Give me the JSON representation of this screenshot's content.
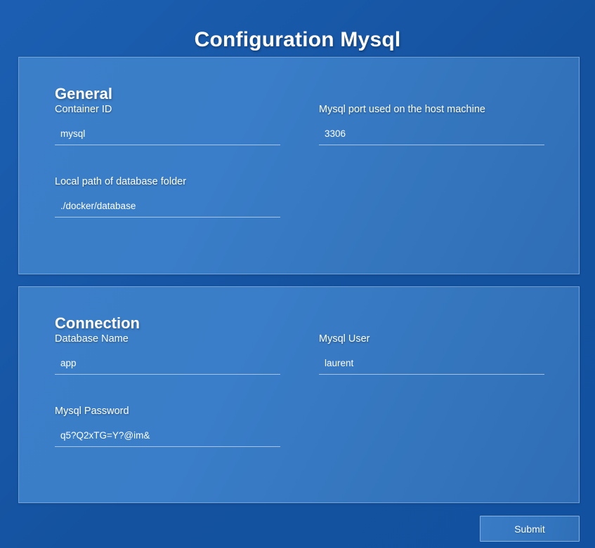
{
  "page": {
    "title": "Configuration Mysql",
    "background_color": "#1a5aab",
    "card_color": "#3a7dc8",
    "text_color": "#ffffff"
  },
  "sections": [
    {
      "id": "general",
      "title": "General",
      "rows": [
        {
          "left": {
            "label": "Container ID",
            "value": "mysql",
            "placeholder": "Container ID"
          },
          "right": {
            "label": "Mysql port used on the host machine",
            "value": "3306",
            "placeholder": "Mysql port used on the host machine"
          }
        },
        {
          "left": {
            "label": "Local path of database folder",
            "value": "./docker/database",
            "placeholder": "Local path of database folder"
          },
          "right": null
        }
      ]
    },
    {
      "id": "connection",
      "title": "Connection",
      "rows": [
        {
          "left": {
            "label": "Database Name",
            "value": "app",
            "placeholder": "Database Name"
          },
          "right": {
            "label": "Mysql User",
            "value": "laurent",
            "placeholder": "Mysql User"
          }
        },
        {
          "left": {
            "label": "Mysql Password",
            "value": "q5?Q2xTG=Y?@im&",
            "placeholder": "Mysql Password"
          },
          "right": null
        }
      ]
    }
  ],
  "footer": {
    "submit_label": "Submit"
  }
}
